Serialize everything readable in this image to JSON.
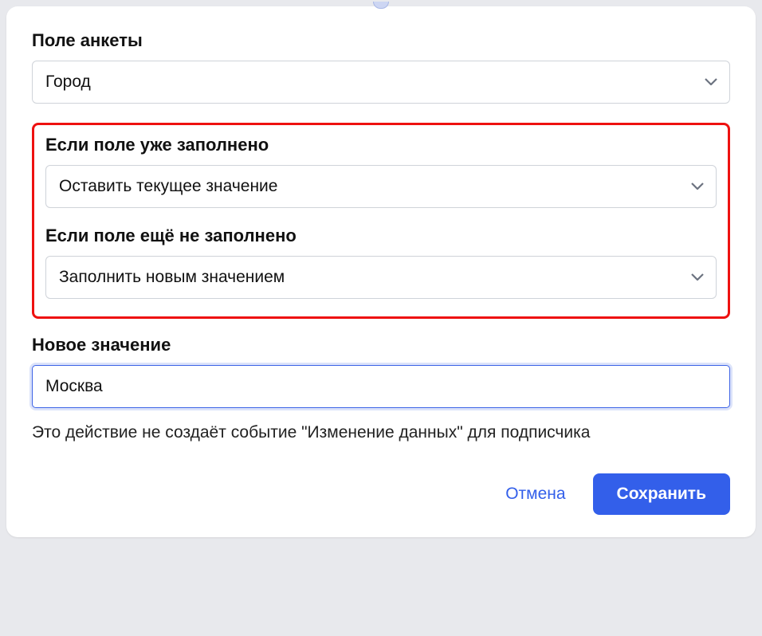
{
  "field1": {
    "label": "Поле анкеты",
    "value": "Город"
  },
  "highlighted": {
    "filled": {
      "label": "Если поле уже заполнено",
      "value": "Оставить текущее значение"
    },
    "not_filled": {
      "label": "Если поле ещё не заполнено",
      "value": "Заполнить новым значением"
    }
  },
  "new_value": {
    "label": "Новое значение",
    "value": "Москва"
  },
  "hint": "Это действие не создаёт событие \"Изменение данных\" для подписчика",
  "actions": {
    "cancel": "Отмена",
    "save": "Сохранить"
  }
}
